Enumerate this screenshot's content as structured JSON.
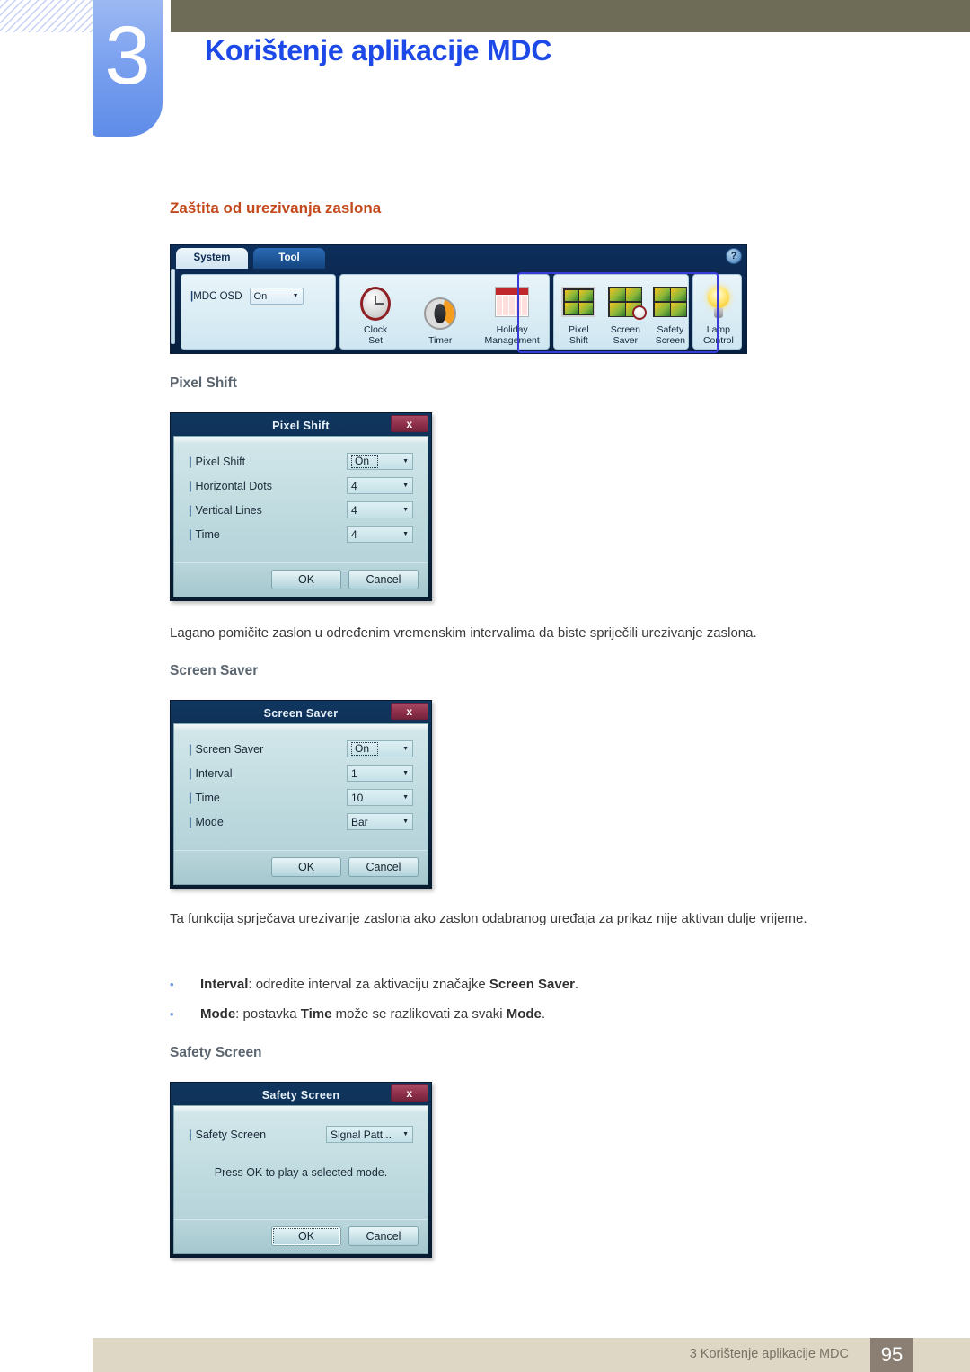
{
  "header": {
    "chapter_number": "3",
    "chapter_title": "Korištenje aplikacije MDC",
    "accent_blue": "#1d49e8",
    "band_color": "#6e6b56"
  },
  "section": {
    "heading": "Zaštita od urezivanja zaslona",
    "heading_color": "#c34a1c"
  },
  "mdc_toolbar": {
    "tabs": [
      {
        "label": "System",
        "active": true
      },
      {
        "label": "Tool",
        "active": false
      }
    ],
    "help_icon": "?",
    "osd": {
      "label": "MDC OSD",
      "value": "On"
    },
    "tools": [
      {
        "label_line1": "Clock",
        "label_line2": "Set",
        "icon": "clock-icon"
      },
      {
        "label_line1": "Timer",
        "label_line2": "",
        "icon": "timer-icon"
      },
      {
        "label_line1": "Holiday",
        "label_line2": "Management",
        "icon": "calendar-icon"
      },
      {
        "label_line1": "Pixel",
        "label_line2": "Shift",
        "icon": "pixel-shift-icon"
      },
      {
        "label_line1": "Screen",
        "label_line2": "Saver",
        "icon": "screen-saver-icon"
      },
      {
        "label_line1": "Safety",
        "label_line2": "Screen",
        "icon": "safety-screen-icon"
      },
      {
        "label_line1": "Lamp",
        "label_line2": "Control",
        "icon": "lamp-icon"
      }
    ],
    "highlight_color": "#3b3bd8"
  },
  "pixel_shift": {
    "sub_heading": "Pixel Shift",
    "dialog": {
      "title": "Pixel Shift",
      "close_label": "x",
      "rows": [
        {
          "label": "Pixel Shift",
          "value": "On",
          "focused": true
        },
        {
          "label": "Horizontal Dots",
          "value": "4",
          "focused": false
        },
        {
          "label": "Vertical Lines",
          "value": "4",
          "focused": false
        },
        {
          "label": "Time",
          "value": "4",
          "focused": false
        }
      ],
      "ok_label": "OK",
      "cancel_label": "Cancel"
    },
    "description": "Lagano pomičite zaslon u određenim vremenskim intervalima da biste spriječili urezivanje zaslona."
  },
  "screen_saver": {
    "sub_heading": "Screen Saver",
    "dialog": {
      "title": "Screen Saver",
      "close_label": "x",
      "rows": [
        {
          "label": "Screen Saver",
          "value": "On",
          "focused": true
        },
        {
          "label": "Interval",
          "value": "1",
          "focused": false
        },
        {
          "label": "Time",
          "value": "10",
          "focused": false
        },
        {
          "label": "Mode",
          "value": "Bar",
          "focused": false
        }
      ],
      "ok_label": "OK",
      "cancel_label": "Cancel"
    },
    "description": "Ta funkcija sprječava urezivanje zaslona ako zaslon odabranog uređaja za prikaz nije aktivan dulje vrijeme.",
    "bullets": [
      {
        "marker": "•",
        "parts": [
          {
            "text": "Interval",
            "bold": true
          },
          {
            "text": ": odredite interval za aktivaciju značajke ",
            "bold": false
          },
          {
            "text": "Screen Saver",
            "bold": true
          },
          {
            "text": ".",
            "bold": false
          }
        ]
      },
      {
        "marker": "•",
        "parts": [
          {
            "text": "Mode",
            "bold": true
          },
          {
            "text": ": postavka ",
            "bold": false
          },
          {
            "text": "Time",
            "bold": true
          },
          {
            "text": " može se razlikovati za svaki ",
            "bold": false
          },
          {
            "text": "Mode",
            "bold": true
          },
          {
            "text": ".",
            "bold": false
          }
        ]
      }
    ]
  },
  "safety_screen": {
    "sub_heading": "Safety Screen",
    "dialog": {
      "title": "Safety Screen",
      "close_label": "x",
      "rows": [
        {
          "label": "Safety Screen",
          "value": "Signal Patt...",
          "focused": false
        }
      ],
      "note": "Press OK to play a selected mode.",
      "ok_label": "OK",
      "cancel_label": "Cancel"
    }
  },
  "footer": {
    "text": "3 Korištenje aplikacije MDC",
    "page_number": "95",
    "band_color": "#ded7c5",
    "page_box_color": "#8a7f72"
  }
}
